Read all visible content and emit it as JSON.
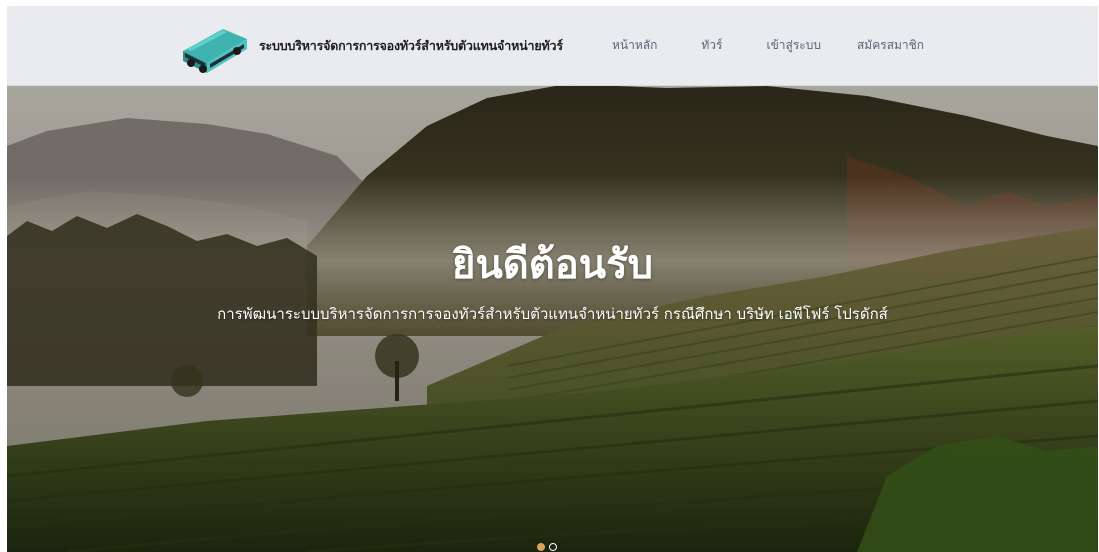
{
  "brand": {
    "logo_icon": "bus-icon",
    "title": "ระบบบริหารจัดการการจองทัวร์สำหรับตัวแทนจำหน่ายทัวร์"
  },
  "nav": {
    "home": "หน้าหลัก",
    "tours": "ทัวร์",
    "login": "เข้าสู่ระบบ",
    "register": "สมัครสมาชิก"
  },
  "hero": {
    "title": "ยินดีต้อนรับ",
    "subtitle": "การพัฒนาระบบบริหารจัดการการจองทัวร์สำหรับตัวแทนจำหน่ายทัวร์ กรณีศึกษา บริษัท เอพีโฟร์ โปรดักส์",
    "background": "misty-tea-plantation-image"
  },
  "carousel": {
    "slide_count": 2,
    "active_index": 0
  },
  "colors": {
    "navbar_bg": "#eef0f4",
    "nav_text": "#5d6470",
    "brand_text": "#1e1e1e",
    "bus_teal": "#4fc3c0",
    "dot_active": "#e0a060"
  }
}
